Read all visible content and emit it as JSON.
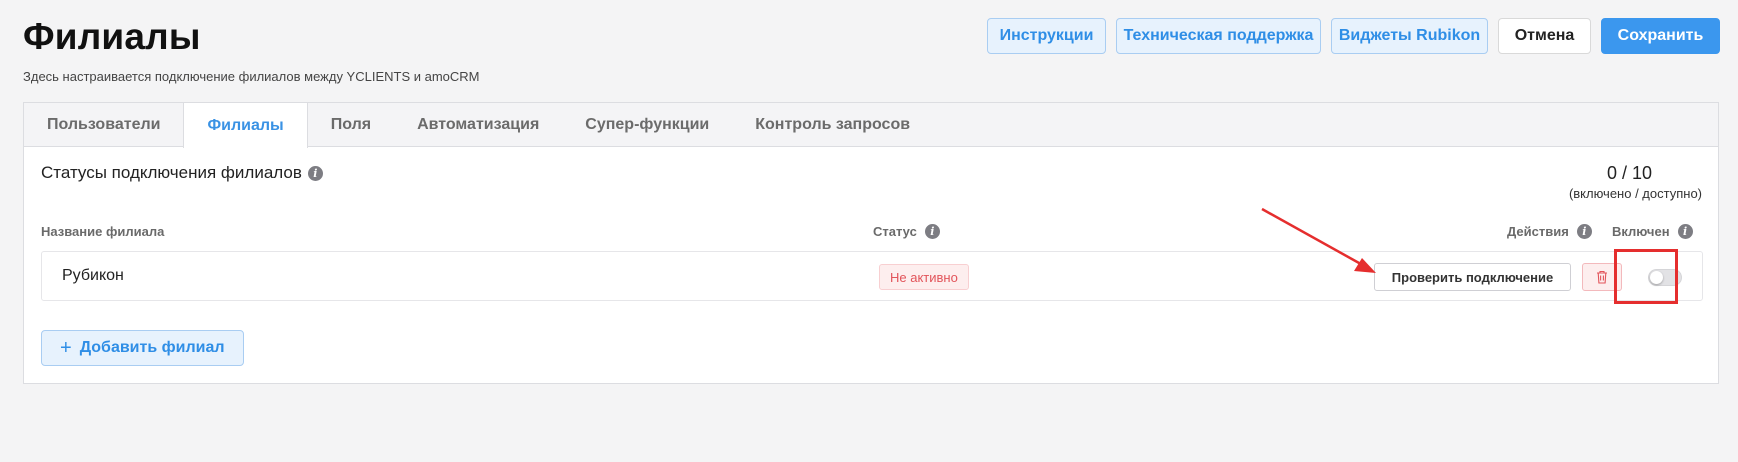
{
  "page": {
    "title": "Филиалы",
    "subtitle": "Здесь настраивается подключение филиалов между YCLIENTS и amoCRM"
  },
  "header_actions": {
    "instructions": "Инструкции",
    "support": "Техническая поддержка",
    "widgets": "Виджеты Rubikon",
    "cancel": "Отмена",
    "save": "Сохранить"
  },
  "tabs": [
    {
      "label": "Пользователи",
      "active": false
    },
    {
      "label": "Филиалы",
      "active": true
    },
    {
      "label": "Поля",
      "active": false
    },
    {
      "label": "Автоматизация",
      "active": false
    },
    {
      "label": "Супер-функции",
      "active": false
    },
    {
      "label": "Контроль запросов",
      "active": false
    }
  ],
  "section": {
    "title": "Статусы подключения филиалов",
    "counter_value": "0 / 10",
    "counter_label": "(включено / доступно)"
  },
  "table": {
    "columns": {
      "name": "Название филиала",
      "status": "Статус",
      "actions": "Действия",
      "enabled": "Включен"
    },
    "rows": [
      {
        "name": "Рубикон",
        "status": "Не активно",
        "check_button": "Проверить подключение",
        "enabled": false
      }
    ]
  },
  "add_button": "Добавить филиал",
  "colors": {
    "accent": "#3b97ee",
    "annotation": "#e52e2e",
    "status_inactive": "#e2545a"
  }
}
